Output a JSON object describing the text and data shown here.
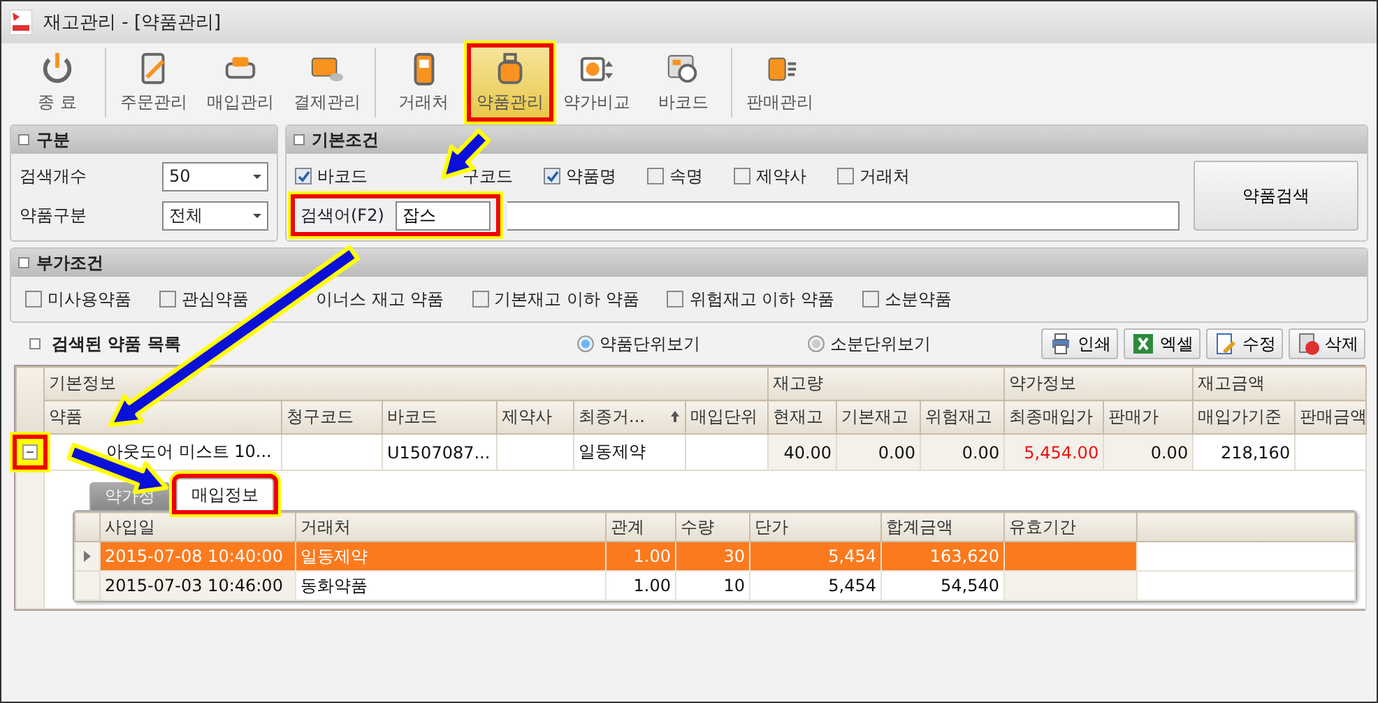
{
  "window": {
    "title": "재고관리 - [약품관리]"
  },
  "toolbar_groups": [
    [
      {
        "label": "종 료",
        "kind": "power",
        "selected": false,
        "highlighted": false
      }
    ],
    [
      {
        "label": "주문관리",
        "kind": "order",
        "selected": false,
        "highlighted": false
      },
      {
        "label": "매입관리",
        "kind": "car",
        "selected": false,
        "highlighted": false
      },
      {
        "label": "결제관리",
        "kind": "card",
        "selected": false,
        "highlighted": false
      }
    ],
    [
      {
        "label": "거래처",
        "kind": "phone",
        "selected": false,
        "highlighted": false
      },
      {
        "label": "약품관리",
        "kind": "weight",
        "selected": true,
        "highlighted": true
      },
      {
        "label": "약가비교",
        "kind": "price",
        "selected": false,
        "highlighted": false
      },
      {
        "label": "바코드",
        "kind": "barcode",
        "selected": false,
        "highlighted": false
      }
    ],
    [
      {
        "label": "판매관리",
        "kind": "sales",
        "selected": false,
        "highlighted": false
      }
    ]
  ],
  "category": {
    "title": "구분",
    "fields": [
      {
        "label": "검색개수",
        "value": "50"
      },
      {
        "label": "약품구분",
        "value": "전체"
      }
    ]
  },
  "basic": {
    "title": "기본조건",
    "options": [
      {
        "kind": "checkbox",
        "label": "바코드",
        "checked": true
      },
      {
        "kind": "covered",
        "label": "구코드"
      },
      {
        "kind": "checkbox",
        "label": "약품명",
        "checked": true
      },
      {
        "kind": "checkbox",
        "label": "속명",
        "checked": false
      },
      {
        "kind": "checkbox",
        "label": "제약사",
        "checked": false
      },
      {
        "kind": "checkbox",
        "label": "거래처",
        "checked": false
      }
    ],
    "search": {
      "label": "검색어(F2)",
      "value": "잡스",
      "highlighted": true
    },
    "search_button": "약품검색"
  },
  "extra": {
    "title": "부가조건",
    "options": [
      {
        "kind": "checkbox",
        "label": "미사용약품",
        "checked": false
      },
      {
        "kind": "checkbox",
        "label": "관심약품",
        "checked": false
      },
      {
        "kind": "covered",
        "label": "이너스 재고 약품"
      },
      {
        "kind": "checkbox",
        "label": "기본재고 이하 약품",
        "checked": false
      },
      {
        "kind": "checkbox",
        "label": "위험재고 이하 약품",
        "checked": false
      },
      {
        "kind": "checkbox",
        "label": "소분약품",
        "checked": false
      }
    ]
  },
  "list": {
    "title": "검색된 약품 목록",
    "views": [
      {
        "label": "약품단위보기",
        "selected": true
      },
      {
        "label": "소분단위보기",
        "selected": false
      }
    ],
    "actions": [
      {
        "label": "인쇄",
        "kind": "print"
      },
      {
        "label": "엑셀",
        "kind": "excel"
      },
      {
        "label": "수정",
        "kind": "edit"
      },
      {
        "label": "삭제",
        "kind": "delete"
      }
    ]
  },
  "grid": {
    "groups": [
      {
        "label": "기본정보",
        "columns": [
          {
            "label": "약품",
            "sorted": false
          },
          {
            "label": "청구코드",
            "sorted": false
          },
          {
            "label": "바코드",
            "sorted": false
          },
          {
            "label": "제약사",
            "sorted": false
          },
          {
            "label": "최종거...",
            "sorted": true
          },
          {
            "label": "매입단위",
            "sorted": false
          }
        ]
      },
      {
        "label": "재고량",
        "columns": [
          {
            "label": "현재고",
            "sorted": false
          },
          {
            "label": "기본재고",
            "sorted": false
          },
          {
            "label": "위험재고",
            "sorted": false
          }
        ]
      },
      {
        "label": "약가정보",
        "columns": [
          {
            "label": "최종매입가",
            "sorted": false
          },
          {
            "label": "판매가",
            "sorted": false
          }
        ]
      },
      {
        "label": "재고금액",
        "columns": [
          {
            "label": "매입가기준",
            "sorted": false
          },
          {
            "label": "판매금액",
            "sorted": false
          }
        ]
      }
    ],
    "rows": [
      {
        "expanded": true,
        "highlighted": true,
        "cells": [
          {
            "text": "아웃도어 미스트 10...",
            "warn": false
          },
          {
            "text": ""
          },
          {
            "text": "U1507087...",
            "warn": false
          },
          {
            "text": ""
          },
          {
            "text": "일동제약",
            "warn": false
          },
          {
            "text": ""
          },
          {
            "text": "40.00",
            "warn": false
          },
          {
            "text": "0.00",
            "warn": false
          },
          {
            "text": "0.00",
            "warn": false
          },
          {
            "text": "5,454.00",
            "warn": true
          },
          {
            "text": "0.00",
            "warn": false
          },
          {
            "text": "218,160",
            "warn": false
          },
          {
            "text": ""
          }
        ],
        "detail": {
          "tabs": [
            {
              "label": "약가정",
              "selected": false,
              "highlighted": false
            },
            {
              "label": "매입정보",
              "selected": true,
              "highlighted": true
            }
          ],
          "columns": [
            "사입일",
            "거래처",
            "관계",
            "수량",
            "단가",
            "합계금액",
            "유효기간"
          ],
          "rows": [
            {
              "selected": true,
              "cells": [
                "2015-07-08 10:40:00",
                "일동제약",
                "1.00",
                "30",
                "5,454",
                "163,620",
                ""
              ]
            },
            {
              "selected": false,
              "cells": [
                "2015-07-03 10:46:00",
                "동화약품",
                "1.00",
                "10",
                "5,454",
                "54,540",
                ""
              ]
            }
          ]
        }
      }
    ]
  }
}
